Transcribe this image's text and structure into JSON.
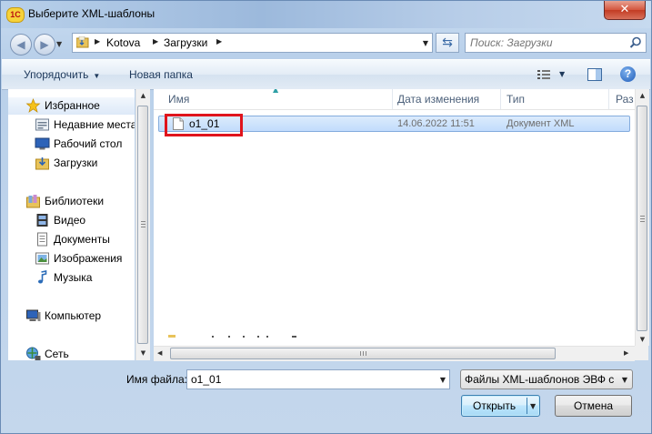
{
  "window": {
    "title": "Выберите XML-шаблоны",
    "app_icon_text": "1С",
    "close_label": "✕"
  },
  "address": {
    "breadcrumbs": [
      "Kotova",
      "Загрузки"
    ],
    "search_placeholder": "Поиск: Загрузки"
  },
  "toolbar": {
    "organize_label": "Упорядочить",
    "new_folder_label": "Новая папка",
    "help_label": "?"
  },
  "nav": {
    "favorites": {
      "label": "Избранное",
      "items": [
        {
          "label": "Недавние места",
          "icon": "recent-places-icon"
        },
        {
          "label": "Рабочий стол",
          "icon": "desktop-icon"
        },
        {
          "label": "Загрузки",
          "icon": "downloads-folder-icon"
        }
      ]
    },
    "libraries": {
      "label": "Библиотеки",
      "items": [
        {
          "label": "Видео",
          "icon": "video-library-icon"
        },
        {
          "label": "Документы",
          "icon": "documents-library-icon"
        },
        {
          "label": "Изображения",
          "icon": "pictures-library-icon"
        },
        {
          "label": "Музыка",
          "icon": "music-library-icon"
        }
      ]
    },
    "computer_label": "Компьютер",
    "network_label": "Сеть"
  },
  "columns": {
    "name": "Имя",
    "date": "Дата изменения",
    "type": "Тип",
    "size": "Раз"
  },
  "files": [
    {
      "name": "o1_01",
      "date": "14.06.2022 11:51",
      "type": "Документ XML"
    }
  ],
  "footer": {
    "filename_label": "Имя файла:",
    "filename_value": "o1_01",
    "filetype_value": "Файлы XML-шаблонов ЭВФ с",
    "open_label": "Открыть",
    "cancel_label": "Отмена"
  },
  "colors": {
    "highlight_box": "#e0141c",
    "selection": "#c1dcfc"
  }
}
